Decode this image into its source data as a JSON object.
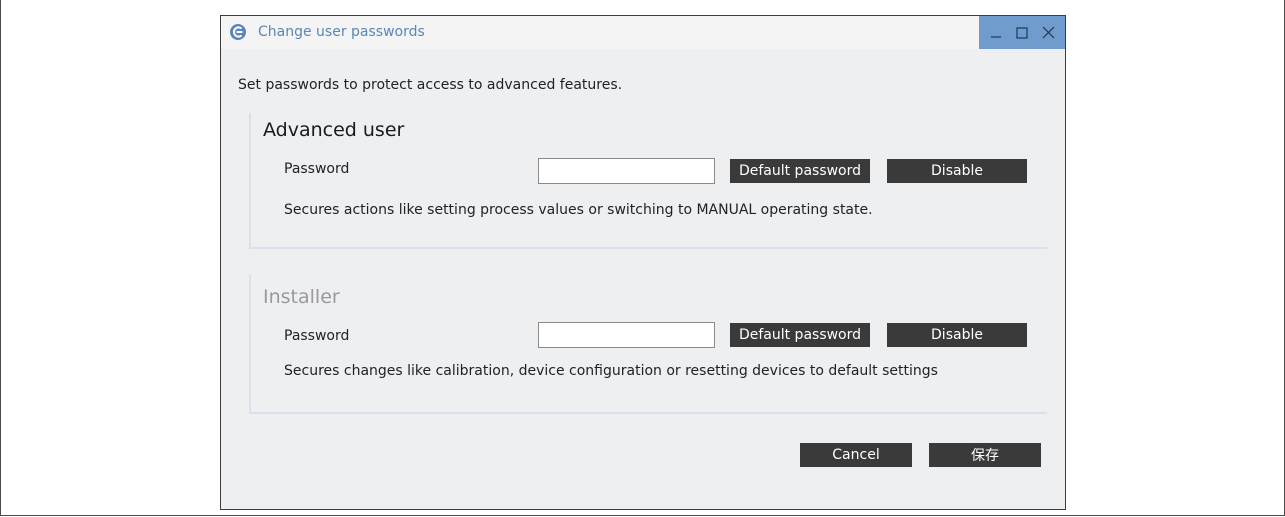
{
  "window": {
    "title": "Change user passwords",
    "controls": [
      "minimize",
      "maximize",
      "close"
    ]
  },
  "intro_text": "Set passwords to protect access to advanced features.",
  "sections": [
    {
      "title": "Advanced user",
      "title_color": "#1a1a1a",
      "password_label": "Password",
      "password_value": "",
      "default_button": "Default password",
      "disable_button": "Disable",
      "description": "Secures actions like setting process values or switching to MANUAL operating state."
    },
    {
      "title": "Installer",
      "title_color": "#9a9a9a",
      "password_label": "Password",
      "password_value": "",
      "default_button": "Default password",
      "disable_button": "Disable",
      "description": "Secures changes like calibration, device configuration or resetting devices to default settings"
    }
  ],
  "footer": {
    "cancel_label": "Cancel",
    "save_label": "保存"
  },
  "colors": {
    "accent": "#6f9ccd",
    "title_text": "#5b86b8",
    "button_dark": "#3a3a3a",
    "dialog_bg": "#eeeff1"
  },
  "icons": {
    "app": "app-logo-icon",
    "minimize": "minimize-icon",
    "maximize": "maximize-icon",
    "close": "close-icon"
  }
}
